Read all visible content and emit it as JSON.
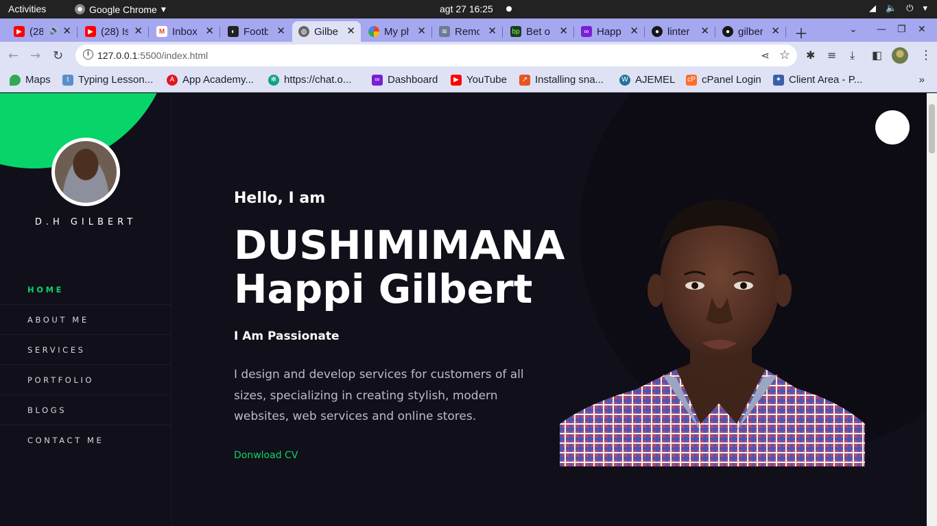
{
  "os_bar": {
    "activities": "Activities",
    "app_name": "Google Chrome",
    "clock": "agt 27  16:25"
  },
  "tabs": [
    {
      "title": "(28",
      "icon": "youtube-icon",
      "color": "#ff0000",
      "audio": true
    },
    {
      "title": "(28) Is",
      "icon": "youtube-icon",
      "color": "#ff0000"
    },
    {
      "title": "Inbox",
      "icon": "gmail-icon",
      "color": "#ea4335"
    },
    {
      "title": "Footb",
      "icon": "football-icon",
      "color": "#222222"
    },
    {
      "title": "Gilber",
      "icon": "globe-icon",
      "color": "#555555",
      "active": true
    },
    {
      "title": "My ph",
      "icon": "google-photos-icon",
      "color": "#fbbc04"
    },
    {
      "title": "Remo",
      "icon": "stack-icon",
      "color": "#6b7c93"
    },
    {
      "title": "Bet or",
      "icon": "bet-icon",
      "color": "#1c3d1c"
    },
    {
      "title": "Happ",
      "icon": "happ-icon",
      "color": "#7a1fd6"
    },
    {
      "title": "linter",
      "icon": "github-icon",
      "color": "#181717"
    },
    {
      "title": "gilber",
      "icon": "github-icon",
      "color": "#181717"
    }
  ],
  "address_bar": {
    "host": "127.0.0.1",
    "path": ":5500/index.html"
  },
  "bookmarks": [
    {
      "label": "Maps",
      "icon": "maps-icon",
      "color": "#34a853"
    },
    {
      "label": "Typing Lesson...",
      "icon": "typing-icon",
      "color": "#5b8ec9"
    },
    {
      "label": "App Academy...",
      "icon": "app-academy-icon",
      "color": "#e0161e"
    },
    {
      "label": "https://chat.o...",
      "icon": "openai-icon",
      "color": "#10a37f"
    },
    {
      "label": "Dashboard",
      "icon": "dashboard-icon",
      "color": "#7a1fd6"
    },
    {
      "label": "YouTube",
      "icon": "youtube-icon",
      "color": "#ff0000"
    },
    {
      "label": "Installing sna...",
      "icon": "snap-icon",
      "color": "#e95420"
    },
    {
      "label": "AJEMEL",
      "icon": "wordpress-icon",
      "color": "#21759b"
    },
    {
      "label": "cPanel Login",
      "icon": "cpanel-icon",
      "color": "#ff6c2c"
    },
    {
      "label": "Client Area - P...",
      "icon": "client-area-icon",
      "color": "#3a5fa8"
    }
  ],
  "site": {
    "brand": "D.H GILBERT",
    "menu": [
      {
        "label": "HOME",
        "active": true
      },
      {
        "label": "ABOUT ME"
      },
      {
        "label": "SERVICES"
      },
      {
        "label": "PORTFOLIO"
      },
      {
        "label": "BLOGS"
      },
      {
        "label": "CONTACT ME"
      }
    ],
    "hero": {
      "greeting": "Hello, I am",
      "name_line1": "DUSHIMIMANA",
      "name_line2": "Happi Gilbert",
      "tagline": "I Am Passionate",
      "description": "I design and develop services for customers of all sizes, specializing in creating stylish, modern websites, web services and online stores.",
      "cta": "Donwload CV"
    },
    "accent": "#07d56a",
    "background": "#110f19"
  }
}
